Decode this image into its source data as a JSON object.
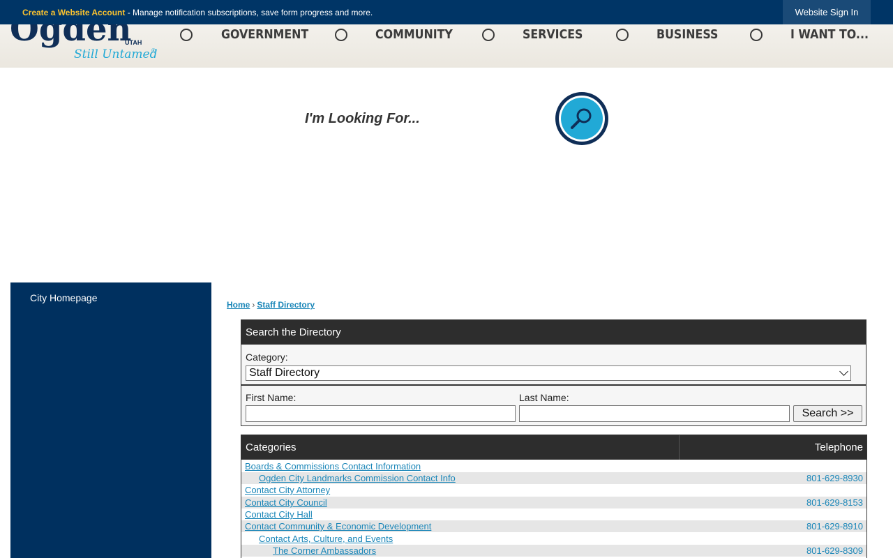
{
  "topbar": {
    "account_link": "Create a Website Account",
    "account_text": " - Manage notification subscriptions, save form progress and more.",
    "signin": "Website Sign In"
  },
  "logo": {
    "main": "Ogden",
    "sub": "UTAH",
    "tagline": "Still Untamed"
  },
  "nav": {
    "items": [
      {
        "label": "GOVERNMENT"
      },
      {
        "label": "COMMUNITY"
      },
      {
        "label": "SERVICES"
      },
      {
        "label": "BUSINESS"
      },
      {
        "label": "I WANT TO..."
      }
    ]
  },
  "search": {
    "prompt": "I'm Looking For..."
  },
  "sidebar": {
    "items": [
      {
        "label": "City Homepage"
      }
    ]
  },
  "breadcrumb": {
    "home": "Home",
    "separator": "›",
    "current": "Staff Directory"
  },
  "directory_search": {
    "title": "Search the Directory",
    "category_label": "Category:",
    "category_value": "Staff Directory",
    "first_name_label": "First Name:",
    "last_name_label": "Last Name:",
    "button": "Search >>"
  },
  "table": {
    "col_categories": "Categories",
    "col_telephone": "Telephone",
    "rows": [
      {
        "label": "Boards & Commissions Contact Information",
        "phone": ""
      },
      {
        "label": "Ogden City Landmarks Commission Contact Info",
        "phone": "801-629-8930"
      },
      {
        "label": "Contact City Attorney",
        "phone": ""
      },
      {
        "label": "Contact City Council",
        "phone": "801-629-8153"
      },
      {
        "label": "Contact City Hall",
        "phone": ""
      },
      {
        "label": "Contact Community & Economic Development",
        "phone": "801-629-8910"
      },
      {
        "label": "Contact Arts, Culture, and Events",
        "phone": ""
      },
      {
        "label": "The Corner Ambassadors",
        "phone": "801-629-8309"
      }
    ]
  },
  "colors": {
    "navy": "#003566",
    "sidebar": "#00305f",
    "accent_yellow": "#f9c230",
    "link_blue": "#1a86b8",
    "search_blue": "#21a9d6"
  }
}
